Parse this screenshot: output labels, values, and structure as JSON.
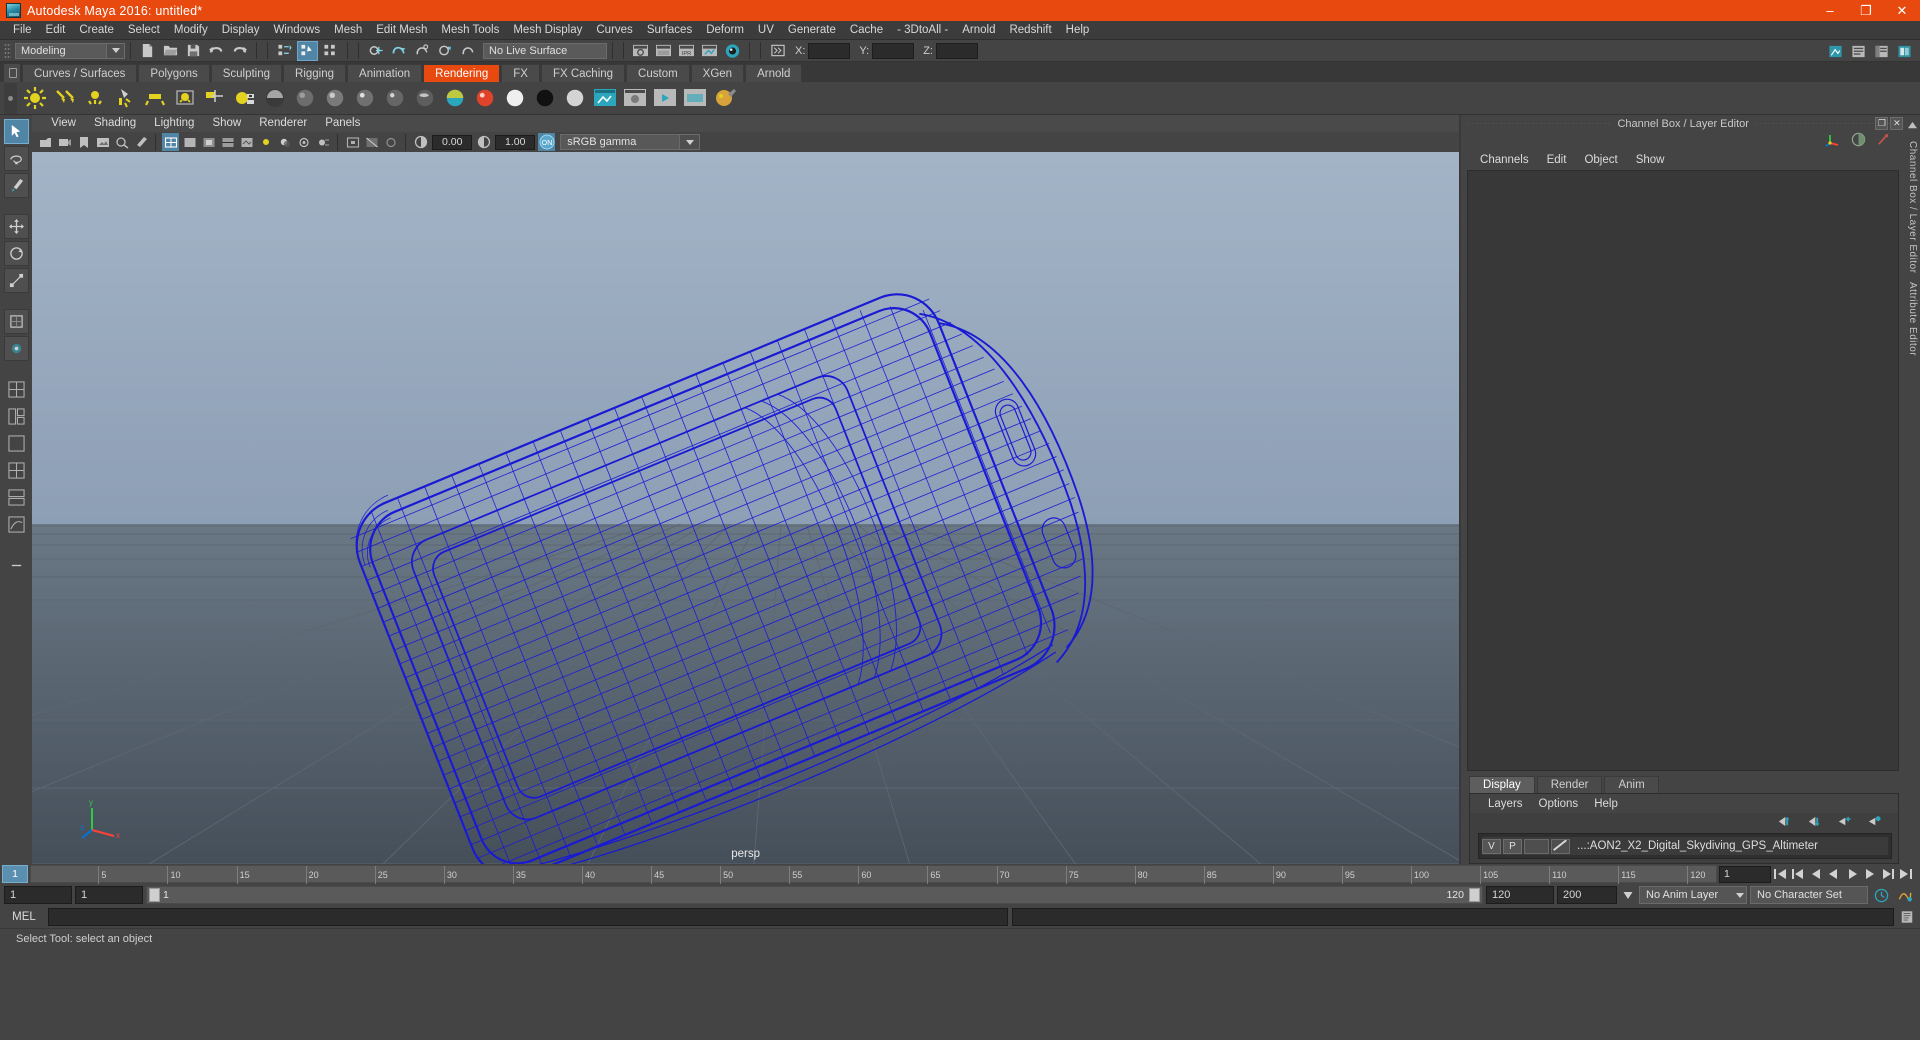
{
  "window": {
    "title": "Autodesk Maya 2016: untitled*",
    "minimize": "–",
    "maximize": "❐",
    "close": "✕",
    "app_icon": "maya-logo-icon"
  },
  "menubar": {
    "items": [
      "File",
      "Edit",
      "Create",
      "Select",
      "Modify",
      "Display",
      "Windows",
      "Mesh",
      "Edit Mesh",
      "Mesh Tools",
      "Mesh Display",
      "Curves",
      "Surfaces",
      "Deform",
      "UV",
      "Generate",
      "Cache",
      "- 3DtoAll -",
      "Arnold",
      "Redshift",
      "Help"
    ]
  },
  "statusline": {
    "menu_set": "Modeling",
    "live_surface": "No Live Surface",
    "axis_x_label": "X:",
    "axis_y_label": "Y:",
    "axis_z_label": "Z:",
    "axis_x_value": "",
    "axis_y_value": "",
    "axis_z_value": ""
  },
  "shelf": {
    "tabs": [
      "Curves / Surfaces",
      "Polygons",
      "Sculpting",
      "Rigging",
      "Animation",
      "Rendering",
      "FX",
      "FX Caching",
      "Custom",
      "XGen",
      "Arnold"
    ],
    "active_tab": "Rendering"
  },
  "panel_menu": {
    "items": [
      "View",
      "Shading",
      "Lighting",
      "Show",
      "Renderer",
      "Panels"
    ]
  },
  "panel_toolbar": {
    "exposure_value": "0.00",
    "gamma_value": "1.00",
    "color_management": "sRGB gamma"
  },
  "viewport": {
    "camera_label": "persp",
    "axis_x": "x",
    "axis_y": "y",
    "axis_z": "z",
    "object_wireframe_color": "#1a1ad0",
    "sky_color": "#9eb0c4",
    "ground_color": "#56626e"
  },
  "channel_box": {
    "title": "Channel Box / Layer Editor",
    "menu": [
      "Channels",
      "Edit",
      "Object",
      "Show"
    ],
    "maximize_glyph": "❐",
    "close_glyph": "✕",
    "side_label": "Channel Box / Layer Editor",
    "side_label_2": "Attribute Editor"
  },
  "layer_editor": {
    "tabs": [
      "Display",
      "Render",
      "Anim"
    ],
    "active_tab": "Display",
    "menu": [
      "Layers",
      "Options",
      "Help"
    ],
    "layers": [
      {
        "visibility": "V",
        "playback": "P",
        "name": "...:AON2_X2_Digital_Skydiving_GPS_Altimeter"
      }
    ]
  },
  "time_slider": {
    "current_frame": "1",
    "ticks": [
      "5",
      "10",
      "15",
      "20",
      "25",
      "30",
      "35",
      "40",
      "45",
      "50",
      "55",
      "60",
      "65",
      "70",
      "75",
      "80",
      "85",
      "90",
      "95",
      "100",
      "105",
      "110",
      "115",
      "120"
    ],
    "end_field": "1"
  },
  "range_slider": {
    "start": "1",
    "anim_start": "1",
    "bar_left_value": "1",
    "bar_right_value": "120",
    "anim_end": "120",
    "end": "200",
    "anim_layer": "No Anim Layer",
    "character_set": "No Character Set"
  },
  "command_line": {
    "label": "MEL",
    "input_value": "",
    "output_value": ""
  },
  "status_bar": {
    "message": "Select Tool: select an object"
  }
}
